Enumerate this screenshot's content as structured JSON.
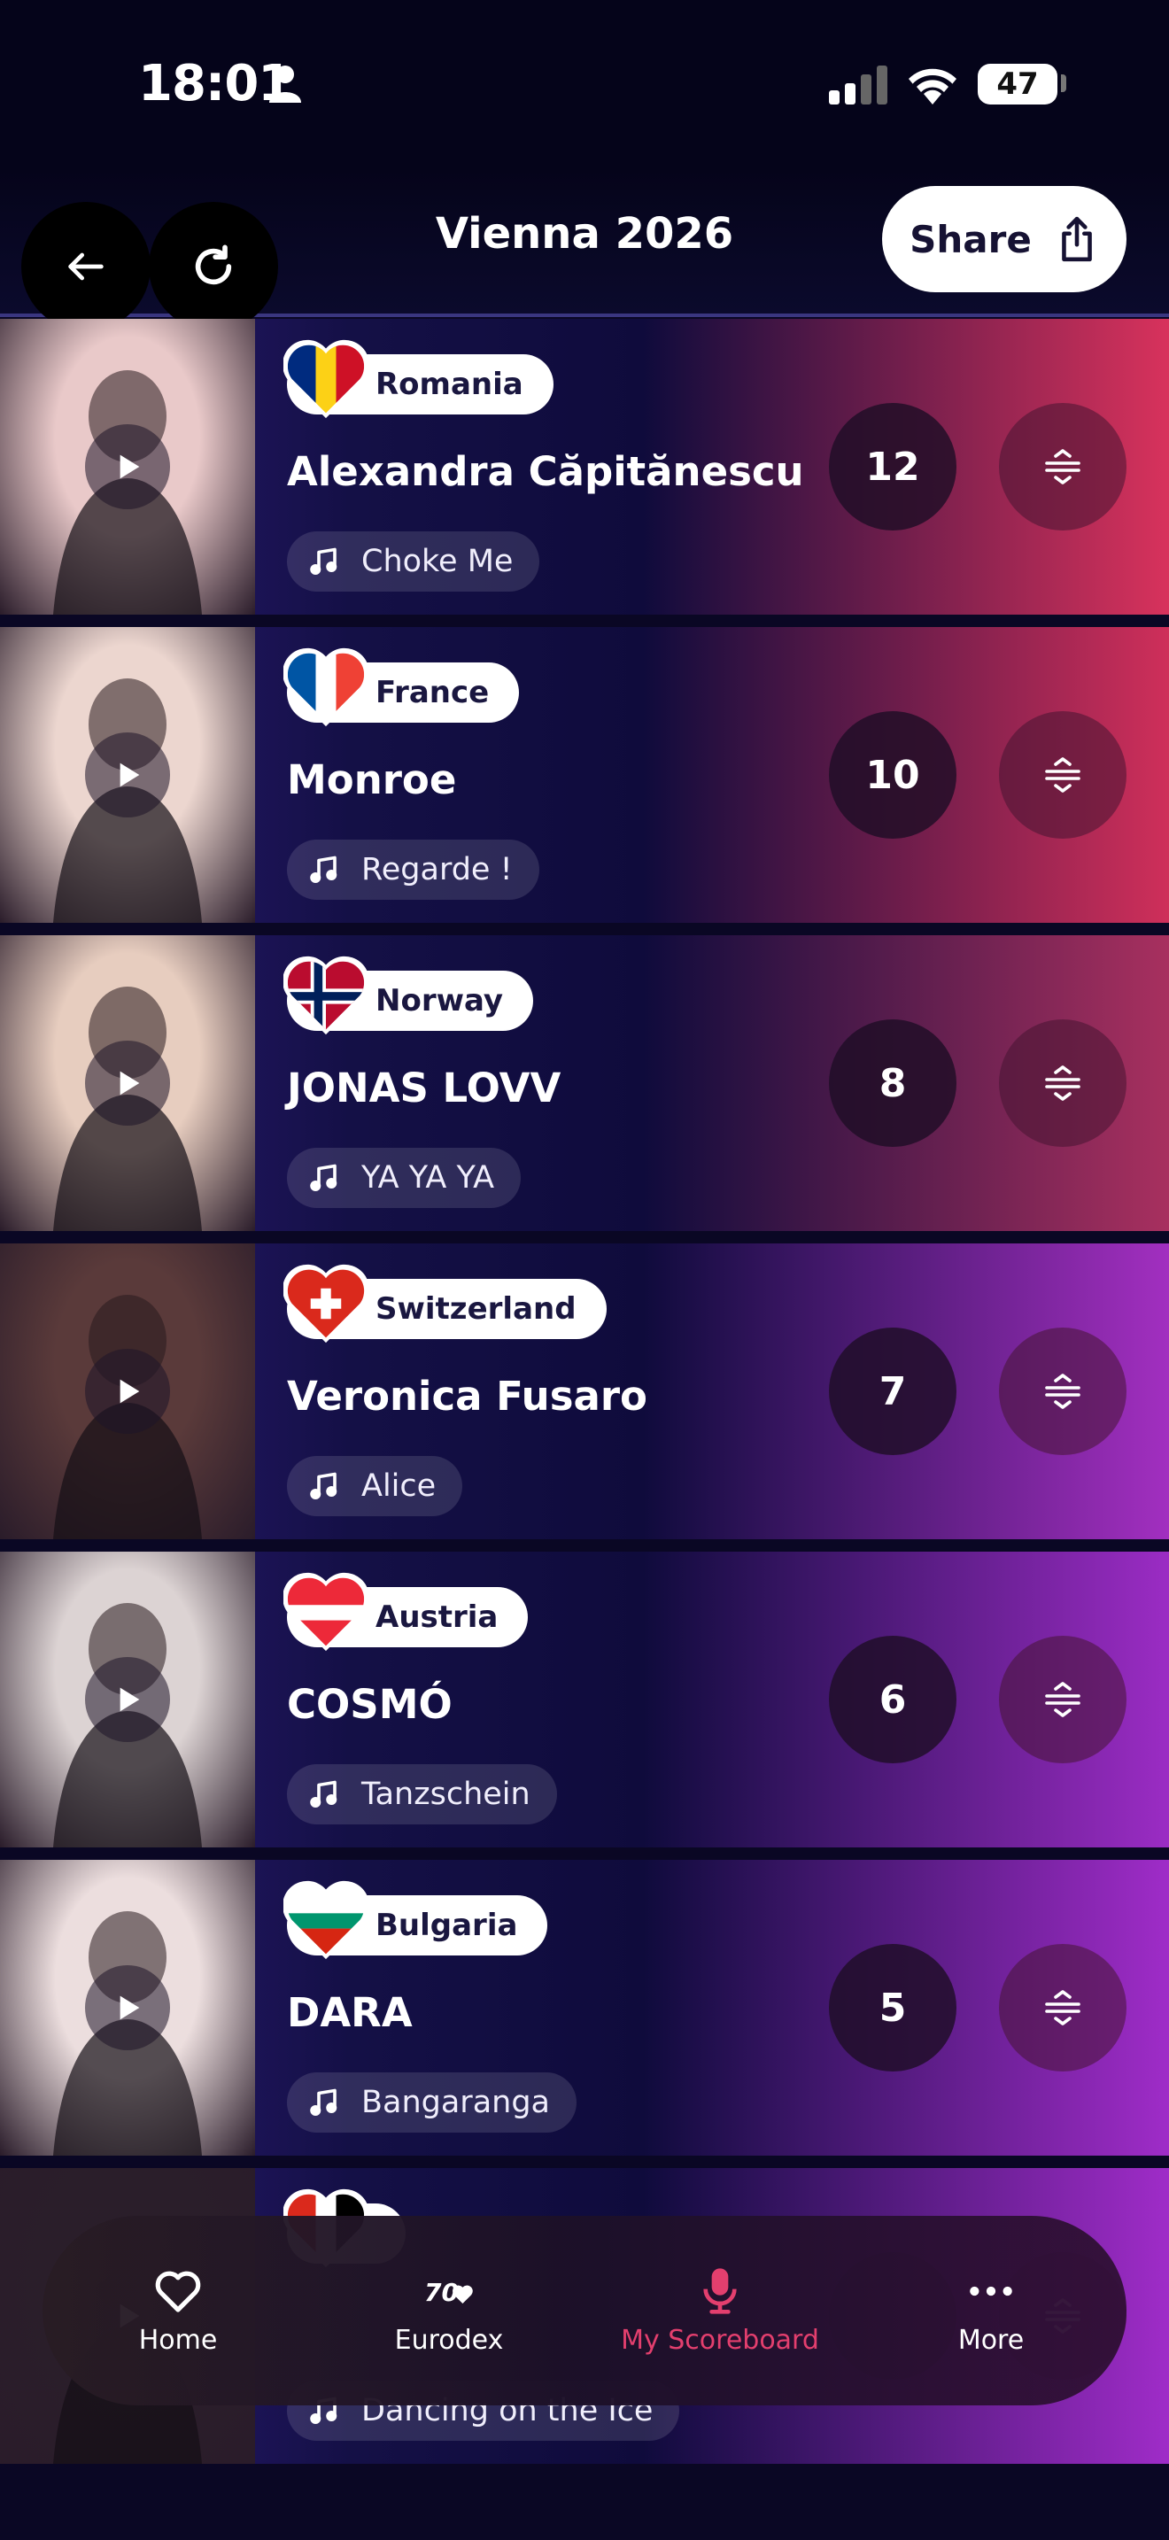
{
  "status_bar": {
    "time": "18:01",
    "battery": "47",
    "icons": [
      "person-icon",
      "signal-icon",
      "wifi-icon",
      "battery-icon"
    ]
  },
  "header": {
    "title": "Vienna 2026",
    "share_label": "Share",
    "back_icon": "arrow-left-icon",
    "refresh_icon": "refresh-icon",
    "share_icon": "share-icon"
  },
  "entries": [
    {
      "country": "Romania",
      "artist": "Alexandra Căpitănescu",
      "song": "Choke Me",
      "points": "12",
      "flag_colors": [
        "#002B7F",
        "#FCD116",
        "#CE1126"
      ],
      "row_accent": "#d8325c",
      "photo_tone": "#e9c9c9"
    },
    {
      "country": "France",
      "artist": "Monroe",
      "song": "Regarde !",
      "points": "10",
      "flag_colors": [
        "#0055A4",
        "#FFFFFF",
        "#EF4135"
      ],
      "row_accent": "#cf2f5a",
      "photo_tone": "#ecd6cf"
    },
    {
      "country": "Norway",
      "artist": "JONAS LOVV",
      "song": "YA YA YA",
      "points": "8",
      "flag_colors": [
        "#BA0C2F",
        "#FFFFFF",
        "#00205B"
      ],
      "row_accent": "#a8305f",
      "photo_tone": "#e7cdbf"
    },
    {
      "country": "Switzerland",
      "artist": "Veronica Fusaro",
      "song": "Alice",
      "points": "7",
      "flag_colors": [
        "#DA291C",
        "#FFFFFF"
      ],
      "row_accent": "#a22fc0",
      "photo_tone": "#5a3a3a"
    },
    {
      "country": "Austria",
      "artist": "COSMÓ",
      "song": "Tanzschein",
      "points": "6",
      "flag_colors": [
        "#ED2939",
        "#FFFFFF",
        "#ED2939"
      ],
      "row_accent": "#9b2cc4",
      "photo_tone": "#dcd3d3"
    },
    {
      "country": "Bulgaria",
      "artist": "DARA",
      "song": "Bangaranga",
      "points": "5",
      "flag_colors": [
        "#FFFFFF",
        "#00966E",
        "#D62612"
      ],
      "row_accent": "#9f2cc8",
      "photo_tone": "#ecdede"
    },
    {
      "country": "",
      "artist": "",
      "song": "Dancing on the Ice",
      "points": "",
      "flag_colors": [
        "#DA291C",
        "#FFFFFF"
      ],
      "row_accent": "#9f2cc8",
      "photo_tone": "#2a1e2a"
    }
  ],
  "bottom_nav": [
    {
      "label": "Home",
      "icon": "heart-icon",
      "active": false
    },
    {
      "label": "Eurodex",
      "icon": "eurodex-logo-icon",
      "active": false
    },
    {
      "label": "My Scoreboard",
      "icon": "microphone-icon",
      "active": true
    },
    {
      "label": "More",
      "icon": "more-dots-icon",
      "active": false
    }
  ],
  "colors": {
    "background": "#0a0724",
    "row_base": "#120d3f",
    "active_nav": "#e33f6e"
  }
}
